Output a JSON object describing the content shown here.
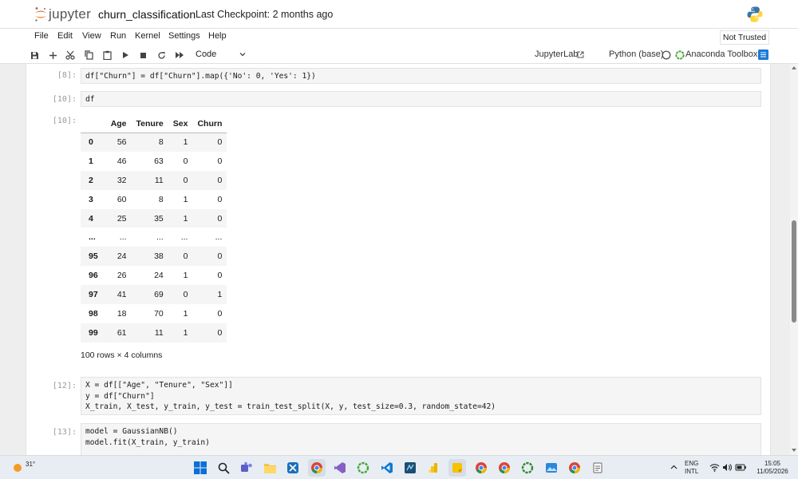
{
  "header": {
    "logo_text": "jupyter",
    "notebook_name": "churn_classification",
    "checkpoint": "Last Checkpoint: 2 months ago"
  },
  "menu": {
    "items": [
      "File",
      "Edit",
      "View",
      "Run",
      "Kernel",
      "Settings",
      "Help"
    ],
    "trust_badge": "Not Trusted"
  },
  "toolbar": {
    "cell_type": "Code",
    "jupyterlab_label": "JupyterLab",
    "kernel_label": "Python (base)",
    "anaconda_label": "Anaconda Toolbox"
  },
  "cells": {
    "c8": {
      "prompt": "[8]:",
      "code": "df[\"Churn\"] = df[\"Churn\"].map({'No': 0, 'Yes': 1})"
    },
    "c10": {
      "prompt": "[10]:",
      "code": "df",
      "out_prompt": "[10]:"
    },
    "c12": {
      "prompt": "[12]:",
      "code_lines": [
        "X = df[[\"Age\", \"Tenure\", \"Sex\"]]",
        "y = df[\"Churn\"]",
        "X_train, X_test, y_train, y_test = train_test_split(X, y, test_size=0.3, random_state=42)"
      ]
    },
    "c13": {
      "prompt": "[13]:",
      "code_lines": [
        "model = GaussianNB()",
        "model.fit(X_train, y_train)"
      ]
    }
  },
  "dataframe": {
    "columns": [
      "",
      "Age",
      "Tenure",
      "Sex",
      "Churn"
    ],
    "rows": [
      [
        "0",
        "56",
        "8",
        "1",
        "0"
      ],
      [
        "1",
        "46",
        "63",
        "0",
        "0"
      ],
      [
        "2",
        "32",
        "11",
        "0",
        "0"
      ],
      [
        "3",
        "60",
        "8",
        "1",
        "0"
      ],
      [
        "4",
        "25",
        "35",
        "1",
        "0"
      ],
      [
        "...",
        "...",
        "...",
        "...",
        "..."
      ],
      [
        "95",
        "24",
        "38",
        "0",
        "0"
      ],
      [
        "96",
        "26",
        "24",
        "1",
        "0"
      ],
      [
        "97",
        "41",
        "69",
        "0",
        "1"
      ],
      [
        "98",
        "18",
        "70",
        "1",
        "0"
      ],
      [
        "99",
        "61",
        "11",
        "1",
        "0"
      ]
    ],
    "shape": "100 rows × 4 columns"
  },
  "taskbar": {
    "weather_temp": "31°",
    "lang_top": "ENG",
    "lang_bottom": "INTL",
    "time": "15:05",
    "date": "11/05/2026"
  },
  "colors": {
    "jupyter_orange": "#f37726",
    "python_blue": "#3776ab",
    "python_yellow": "#ffd43b",
    "anaconda_green": "#44a833",
    "toolbox_blue": "#1c7ad6"
  }
}
